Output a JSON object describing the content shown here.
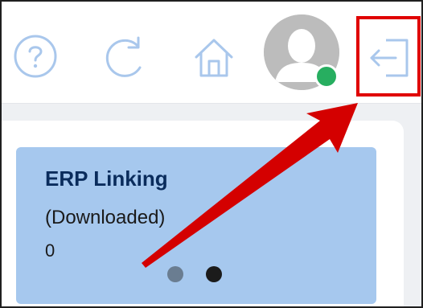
{
  "header": {
    "icons": {
      "help": "question-circle-icon",
      "refresh": "refresh-icon",
      "home": "home-icon",
      "avatar": "user-avatar-icon",
      "logout": "logout-icon"
    },
    "colors": {
      "icon_blue": "#a9c7ec",
      "status_online": "#27ae60",
      "highlight_red": "#e00000"
    }
  },
  "card": {
    "title": "ERP Linking",
    "subtitle": "(Downloaded)",
    "count": "0",
    "background": "#a6c8ee"
  },
  "carousel": {
    "pages": 2,
    "active_page": 2
  }
}
